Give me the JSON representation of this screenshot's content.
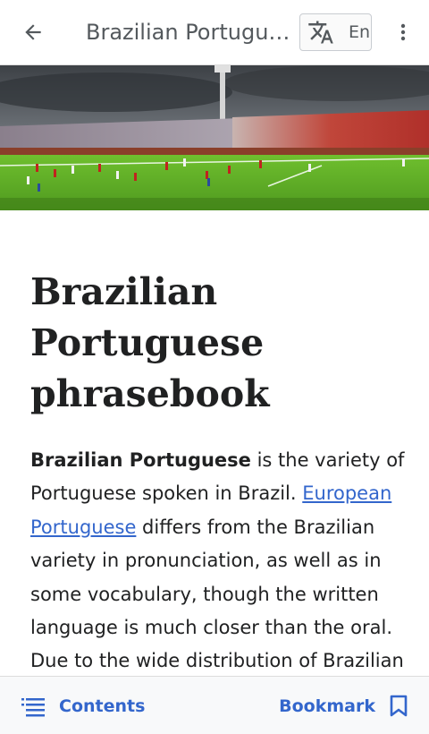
{
  "appbar": {
    "back_icon": "arrow-left-icon",
    "title": "Brazilian Portuguese phrasebook",
    "language_icon": "translate-icon",
    "language_code": "En",
    "more_icon": "more-vert-icon"
  },
  "banner": {
    "image": "stadium-football-match-photo"
  },
  "article": {
    "title": "Brazilian Portuguese phrasebook",
    "lead_bold": "Brazilian Portuguese",
    "lead_part1": " is the variety of Portuguese spoken in Brazil. ",
    "lead_link": "European Portuguese",
    "lead_part2": " differs from the Brazilian variety in pronunciation, as well as in some vocabulary, though the written language is much closer than the oral. Due to the wide distribution of Brazilian"
  },
  "bottombar": {
    "contents_icon": "list-icon",
    "contents_label": "Contents",
    "bookmark_label": "Bookmark",
    "bookmark_icon": "bookmark-icon"
  },
  "colors": {
    "link": "#3366cc",
    "text": "#202122",
    "icon": "#54595d",
    "bottombar_bg": "#f8f9fa"
  }
}
